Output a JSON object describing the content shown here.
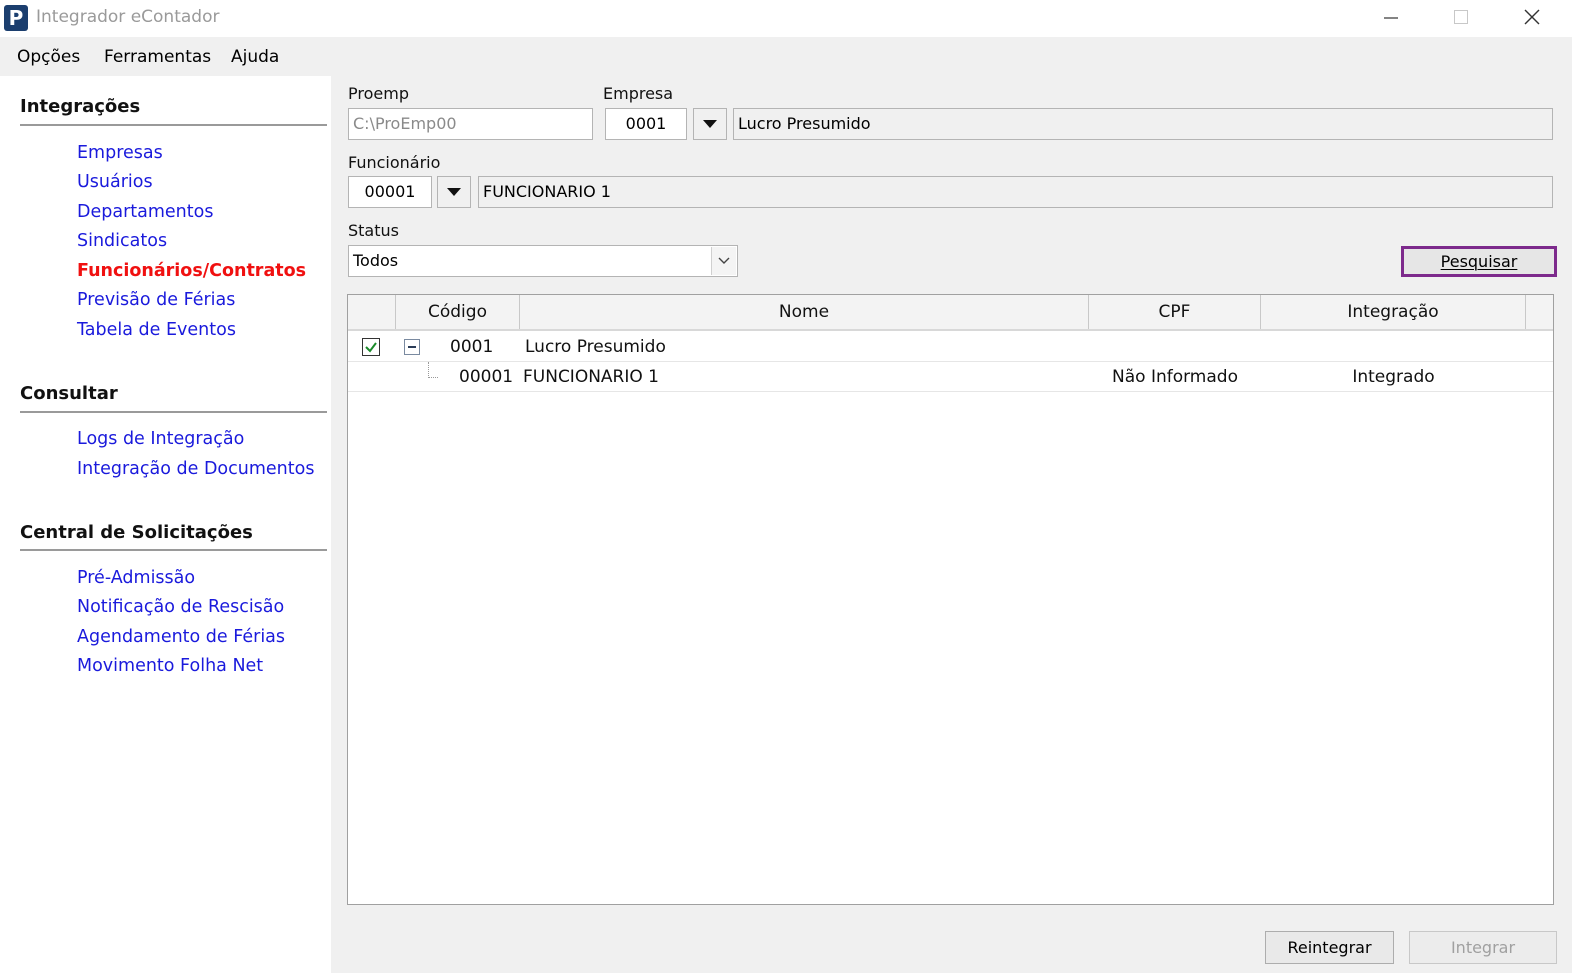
{
  "window": {
    "title": "Integrador eContador",
    "logo_letter": "P"
  },
  "menu": [
    {
      "label": "Opções"
    },
    {
      "label": "Ferramentas"
    },
    {
      "label": "Ajuda"
    }
  ],
  "sidebar": {
    "integracoes": {
      "title": "Integrações",
      "items": [
        "Empresas",
        "Usuários",
        "Departamentos",
        "Sindicatos",
        "Funcionários/Contratos",
        "Previsão de Férias",
        "Tabela de Eventos"
      ],
      "active": "Funcionários/Contratos"
    },
    "consultar": {
      "title": "Consultar",
      "items": [
        "Logs de Integração",
        "Integração de Documentos"
      ]
    },
    "central": {
      "title": "Central de Solicitações",
      "items": [
        "Pré-Admissão",
        "Notificação de Rescisão",
        "Agendamento de Férias",
        "Movimento Folha Net"
      ]
    }
  },
  "form": {
    "proemp_label": "Proemp",
    "proemp_value": "C:\\ProEmp00",
    "empresa_label": "Empresa",
    "empresa_code": "0001",
    "empresa_name": "Lucro Presumido",
    "funcionario_label": "Funcionário",
    "funcionario_code": "00001",
    "funcionario_name": "FUNCIONARIO 1",
    "status_label": "Status",
    "status_value": "Todos",
    "search_button": "Pesquisar"
  },
  "grid": {
    "columns": [
      "Código",
      "Nome",
      "CPF",
      "Integração"
    ],
    "group_row": {
      "checked": true,
      "codigo": "0001",
      "nome": "Lucro Presumido"
    },
    "child_rows": [
      {
        "codigo": "00001",
        "nome": "FUNCIONARIO 1",
        "cpf": "Não Informado",
        "integracao": "Integrado"
      }
    ]
  },
  "footer": {
    "reintegrar": "Reintegrar",
    "integrar": "Integrar"
  },
  "colors": {
    "link": "#1a1adc",
    "active_link": "#f01010",
    "focus_border": "#7d2a8c"
  }
}
